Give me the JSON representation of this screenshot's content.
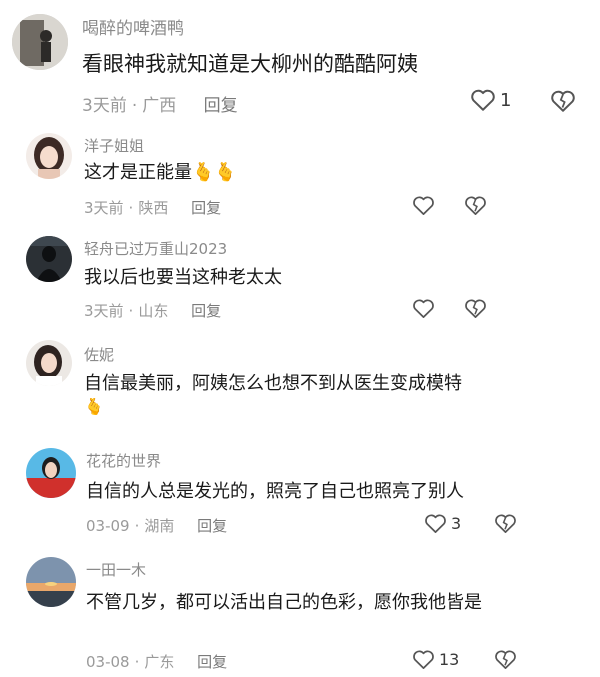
{
  "comments": [
    {
      "username": "喝醉的啤酒鸭",
      "text": "看眼神我就知道是大柳州的酷酷阿姨",
      "emoji": "",
      "time": "3天前",
      "location": "广西",
      "reply": "回复",
      "likes": "1"
    },
    {
      "username": "洋子姐姐",
      "text": "这才是正能量",
      "emoji": "🫰🫰",
      "time": "3天前",
      "location": "陕西",
      "reply": "回复",
      "likes": ""
    },
    {
      "username": "轻舟已过万重山2023",
      "text": "我以后也要当这种老太太",
      "emoji": "",
      "time": "3天前",
      "location": "山东",
      "reply": "回复",
      "likes": ""
    },
    {
      "username": "佐妮",
      "text": "自信最美丽，阿姨怎么也想不到从医生变成模特",
      "emoji": "🫰",
      "time": "",
      "location": "",
      "reply": "",
      "likes": ""
    },
    {
      "username": "花花的世界",
      "text": "自信的人总是发光的，照亮了自己也照亮了别人",
      "emoji": "",
      "time": "03-09",
      "location": "湖南",
      "reply": "回复",
      "likes": "3"
    },
    {
      "username": "一田一木",
      "text": "不管几岁，都可以活出自己的色彩，愿你我他皆是",
      "emoji": "",
      "time": "03-08",
      "location": "广东",
      "reply": "回复",
      "likes": "13"
    }
  ],
  "icons": {
    "like": "heart-outline-icon",
    "dislike": "broken-heart-icon"
  },
  "colors": {
    "username": "#8a8a8a",
    "text": "#1a1a1a",
    "meta": "#9a9a9a"
  }
}
